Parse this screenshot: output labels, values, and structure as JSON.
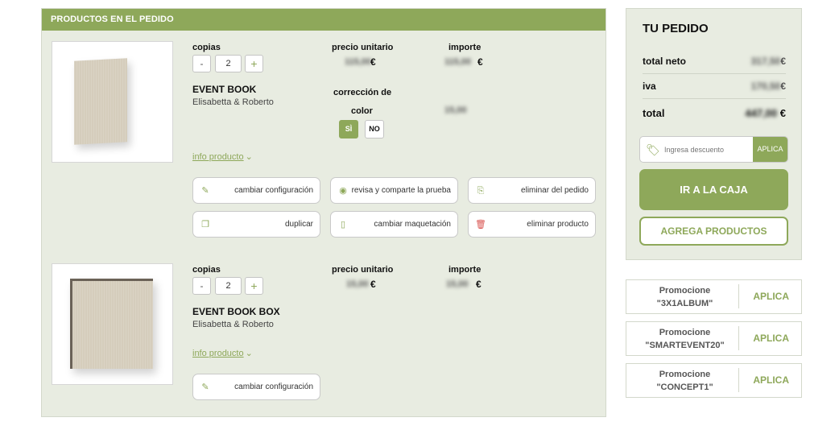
{
  "left_panel": {
    "title": "PRODUCTOS EN EL PEDIDO",
    "labels": {
      "copies": "copias",
      "unit_price": "precio unitario",
      "amount": "importe",
      "color_correction": "corrección de",
      "color_correction_2": "color",
      "info": "info producto",
      "yes": "SÌ",
      "no": "NO"
    },
    "products": [
      {
        "name": "EVENT BOOK",
        "subtitle": "Elisabetta & Roberto",
        "quantity": "2",
        "unit_price": "115,00",
        "amount": "115,00",
        "color_correction_price": "15,00",
        "currency": "€",
        "actions": [
          {
            "label": "cambiar configuración",
            "icon": "edit-icon"
          },
          {
            "label": "revisa y comparte la prueba",
            "icon": "eye-icon"
          },
          {
            "label": "eliminar del pedido",
            "icon": "remove-from-order-icon"
          },
          {
            "label": "duplicar",
            "icon": "duplicate-icon"
          },
          {
            "label": "cambiar maquetación",
            "icon": "book-open-icon"
          },
          {
            "label": "eliminar producto",
            "icon": "trash-icon"
          }
        ]
      },
      {
        "name": "EVENT BOOK BOX",
        "subtitle": "Elisabetta & Roberto",
        "quantity": "2",
        "unit_price": "15,00",
        "amount": "15,00",
        "currency": "€",
        "actions": [
          {
            "label": "cambiar configuración",
            "icon": "edit-icon"
          }
        ]
      }
    ]
  },
  "order": {
    "title": "TU PEDIDO",
    "net_label": "total neto",
    "net_value": "317,50",
    "vat_label": "iva",
    "vat_value": "170,50",
    "total_label": "total",
    "total_value": "447,00",
    "currency": "€",
    "discount_placeholder": "Ingresa descuento",
    "discount_apply": "APLICA",
    "checkout": "IR A LA CAJA",
    "add_products": "AGREGA PRODUCTOS"
  },
  "promotions": [
    {
      "line1": "Promocione",
      "line2": "\"3X1ALBUM\"",
      "action": "APLICA"
    },
    {
      "line1": "Promocione",
      "line2": "\"SMARTEVENT20\"",
      "action": "APLICA"
    },
    {
      "line1": "Promocione",
      "line2": "\"CONCEPT1\"",
      "action": "APLICA"
    }
  ],
  "colors": {
    "accent": "#8ea85a",
    "panel": "#e8ece1",
    "danger": "#d9534f"
  }
}
